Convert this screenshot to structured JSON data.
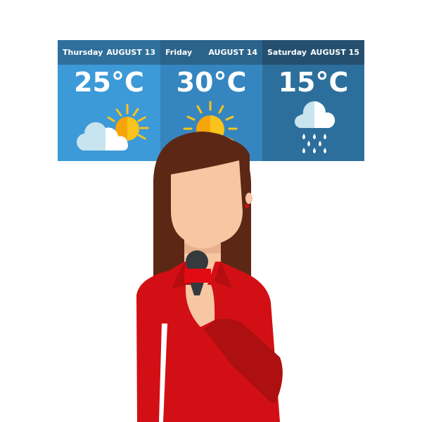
{
  "forecast": [
    {
      "day": "Thursday",
      "date": "AUGUST 13",
      "temperature": "25°C",
      "condition": "partly-cloudy",
      "icon": "sun-cloud-icon"
    },
    {
      "day": "Friday",
      "date": "AUGUST 14",
      "temperature": "30°C",
      "condition": "sunny",
      "icon": "sun-icon"
    },
    {
      "day": "Saturday",
      "date": "AUGUST 15",
      "temperature": "15°C",
      "condition": "rain",
      "icon": "rain-cloud-icon"
    }
  ],
  "colors": {
    "panel_1": "#3d9ad8",
    "panel_2": "#3586c0",
    "panel_3": "#2d6f9c",
    "sun": "#f9c31b",
    "sun_shade": "#f5a50a",
    "cloud_light": "#c8e4ef",
    "shirt": "#d20f14",
    "hair": "#5c2815",
    "skin": "#f7c6a3"
  }
}
